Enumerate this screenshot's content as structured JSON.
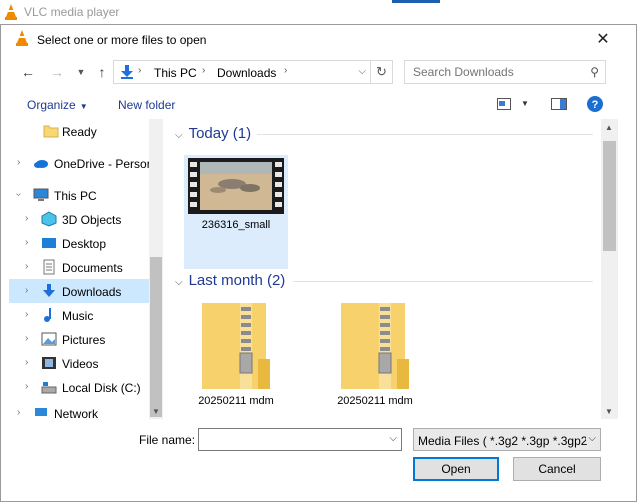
{
  "vlc": {
    "title": "VLC media player"
  },
  "dialog": {
    "title": "Select one or more files to open",
    "address": {
      "segments": [
        "This PC",
        "Downloads"
      ]
    },
    "search": {
      "placeholder": "Search Downloads"
    },
    "toolbar": {
      "organize": "Organize",
      "new_folder": "New folder"
    },
    "tree": {
      "items": [
        {
          "label": "Ready",
          "icon": "folder-icon",
          "has_arrow": false
        },
        {
          "label": "OneDrive - Persor",
          "icon": "onedrive-icon",
          "has_arrow": true
        },
        {
          "label": "This PC",
          "icon": "this-pc-icon",
          "has_arrow": true,
          "expanded": true
        },
        {
          "label": "3D Objects",
          "icon": "3d-objects-icon",
          "has_arrow": true
        },
        {
          "label": "Desktop",
          "icon": "desktop-icon",
          "has_arrow": true
        },
        {
          "label": "Documents",
          "icon": "documents-icon",
          "has_arrow": true
        },
        {
          "label": "Downloads",
          "icon": "downloads-icon",
          "has_arrow": true,
          "selected": true
        },
        {
          "label": "Music",
          "icon": "music-icon",
          "has_arrow": true
        },
        {
          "label": "Pictures",
          "icon": "pictures-icon",
          "has_arrow": true
        },
        {
          "label": "Videos",
          "icon": "videos-icon",
          "has_arrow": true
        },
        {
          "label": "Local Disk (C:)",
          "icon": "local-disk-icon",
          "has_arrow": true
        },
        {
          "label": "Network",
          "icon": "network-icon",
          "has_arrow": true
        }
      ]
    },
    "groups": [
      {
        "label": "Today (1)",
        "files": [
          {
            "name": "236316_small",
            "type": "video"
          }
        ]
      },
      {
        "label": "Last month (2)",
        "files": [
          {
            "name": "20250211 mdm",
            "type": "zip"
          },
          {
            "name": "20250211 mdm",
            "type": "zip"
          }
        ]
      }
    ],
    "footer": {
      "file_name_label": "File name:",
      "file_name_value": "",
      "file_type": "Media Files ( *.3g2 *.3gp *.3gp2",
      "open": "Open",
      "cancel": "Cancel"
    }
  },
  "colors": {
    "accent": "#0078d7",
    "link": "#1f3a93",
    "selected": "#cce8ff"
  }
}
